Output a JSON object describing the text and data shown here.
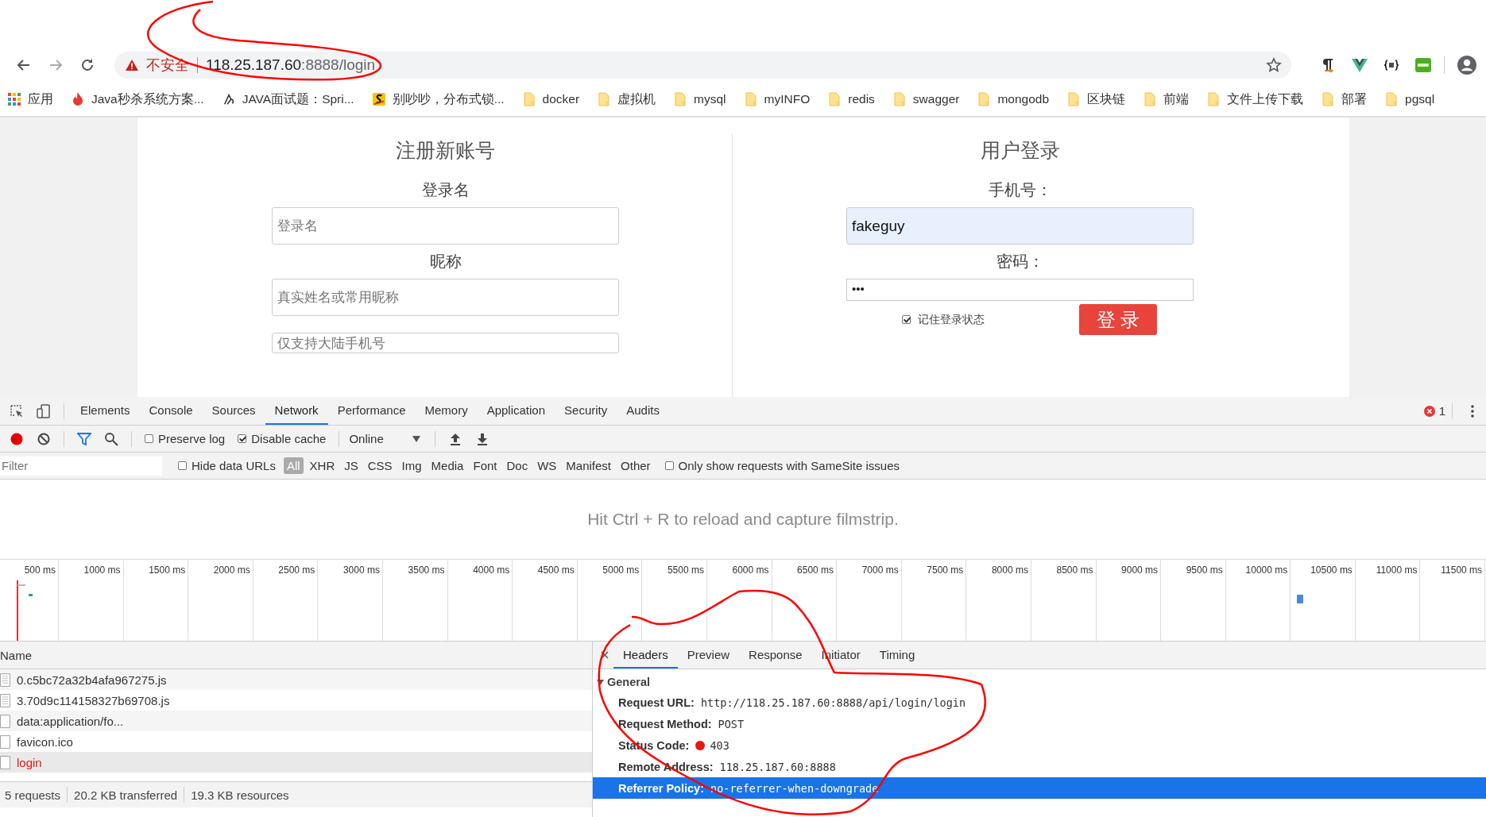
{
  "browser": {
    "security_label": "不安全",
    "url_host": "118.25.187.60",
    "url_rest": ":8888/login",
    "bookmarks": [
      {
        "label": "应用",
        "kind": "apps"
      },
      {
        "label": "Java秒杀系统方案...",
        "kind": "flame"
      },
      {
        "label": "JAVA面试题：Spri...",
        "kind": "glyph"
      },
      {
        "label": "别吵吵，分布式锁...",
        "kind": "s-logo"
      },
      {
        "label": "docker",
        "kind": "folder"
      },
      {
        "label": "虚拟机",
        "kind": "folder"
      },
      {
        "label": "mysql",
        "kind": "folder"
      },
      {
        "label": "myINFO",
        "kind": "folder"
      },
      {
        "label": "redis",
        "kind": "folder"
      },
      {
        "label": "swagger",
        "kind": "folder"
      },
      {
        "label": "mongodb",
        "kind": "folder"
      },
      {
        "label": "区块链",
        "kind": "folder"
      },
      {
        "label": "前端",
        "kind": "folder"
      },
      {
        "label": "文件上传下载",
        "kind": "folder"
      },
      {
        "label": "部署",
        "kind": "folder"
      },
      {
        "label": "pgsql",
        "kind": "folder"
      }
    ]
  },
  "register": {
    "title": "注册新账号",
    "fields": [
      {
        "label": "登录名",
        "placeholder": "登录名"
      },
      {
        "label": "昵称",
        "placeholder": "真实姓名或常用昵称"
      },
      {
        "placeholder": "仅支持大陆手机号"
      }
    ]
  },
  "login": {
    "title": "用户登录",
    "phone_label": "手机号：",
    "phone_value": "fakeguy",
    "password_label": "密码：",
    "password_value": "•••",
    "remember": {
      "label": "记住登录状态",
      "checked": true
    },
    "submit": "登 录"
  },
  "devtools": {
    "panel_tabs": [
      {
        "label": "Elements",
        "selected": false
      },
      {
        "label": "Console",
        "selected": false
      },
      {
        "label": "Sources",
        "selected": false
      },
      {
        "label": "Network",
        "selected": true
      },
      {
        "label": "Performance",
        "selected": false
      },
      {
        "label": "Memory",
        "selected": false
      },
      {
        "label": "Application",
        "selected": false
      },
      {
        "label": "Security",
        "selected": false
      },
      {
        "label": "Audits",
        "selected": false
      }
    ],
    "error_count": "1",
    "toolbar": {
      "recording": true,
      "preserve_log": {
        "label": "Preserve log",
        "checked": false
      },
      "disable_cache": {
        "label": "Disable cache",
        "checked": true
      },
      "throttling": "Online"
    },
    "filter": {
      "placeholder": "Filter",
      "hide_data_urls": {
        "label": "Hide data URLs",
        "checked": false
      },
      "types": [
        {
          "label": "All",
          "selected": true
        },
        {
          "label": "XHR",
          "selected": false
        },
        {
          "label": "JS",
          "selected": false
        },
        {
          "label": "CSS",
          "selected": false
        },
        {
          "label": "Img",
          "selected": false
        },
        {
          "label": "Media",
          "selected": false
        },
        {
          "label": "Font",
          "selected": false
        },
        {
          "label": "Doc",
          "selected": false
        },
        {
          "label": "WS",
          "selected": false
        },
        {
          "label": "Manifest",
          "selected": false
        },
        {
          "label": "Other",
          "selected": false
        }
      ],
      "samesite": {
        "label": "Only show requests with SameSite issues",
        "checked": false
      }
    },
    "filmstrip_hint": "Hit Ctrl + R to reload and capture filmstrip.",
    "timeline_ticks": [
      "500 ms",
      "1000 ms",
      "1500 ms",
      "2000 ms",
      "2500 ms",
      "3000 ms",
      "3500 ms",
      "4000 ms",
      "4500 ms",
      "5000 ms",
      "5500 ms",
      "6000 ms",
      "6500 ms",
      "7000 ms",
      "7500 ms",
      "8000 ms",
      "8500 ms",
      "9000 ms",
      "9500 ms",
      "10000 ms",
      "10500 ms",
      "11000 ms",
      "11500 ms"
    ],
    "requests": {
      "column": "Name",
      "rows": [
        {
          "name": "0.c5bc72a32b4afa967275.js",
          "kind": "script",
          "failed": false,
          "selected": false
        },
        {
          "name": "3.70d9c114158327b69708.js",
          "kind": "script",
          "failed": false,
          "selected": false
        },
        {
          "name": "data:application/fo...",
          "kind": "plain",
          "failed": false,
          "selected": false
        },
        {
          "name": "favicon.ico",
          "kind": "plain",
          "failed": false,
          "selected": false
        },
        {
          "name": "login",
          "kind": "plain",
          "failed": true,
          "selected": true
        }
      ]
    },
    "details": {
      "tabs": [
        {
          "label": "Headers",
          "selected": true
        },
        {
          "label": "Preview",
          "selected": false
        },
        {
          "label": "Response",
          "selected": false
        },
        {
          "label": "Initiator",
          "selected": false
        },
        {
          "label": "Timing",
          "selected": false
        }
      ],
      "section": {
        "title": "General",
        "expanded": true,
        "rows": [
          {
            "key": "Request URL:",
            "value": "http://118.25.187.60:8888/api/login/login",
            "kind": "text",
            "selected": false
          },
          {
            "key": "Request Method:",
            "value": "POST",
            "kind": "text",
            "selected": false
          },
          {
            "key": "Status Code:",
            "value": "403",
            "kind": "status",
            "color": "#e8170f",
            "selected": false
          },
          {
            "key": "Remote Address:",
            "value": "118.25.187.60:8888",
            "kind": "text",
            "selected": false
          },
          {
            "key": "Referrer Policy:",
            "value": "no-referrer-when-downgrade",
            "kind": "text",
            "selected": true
          }
        ]
      }
    },
    "status_bar": [
      "5 requests",
      "20.2 KB transferred",
      "19.3 KB resources"
    ]
  }
}
